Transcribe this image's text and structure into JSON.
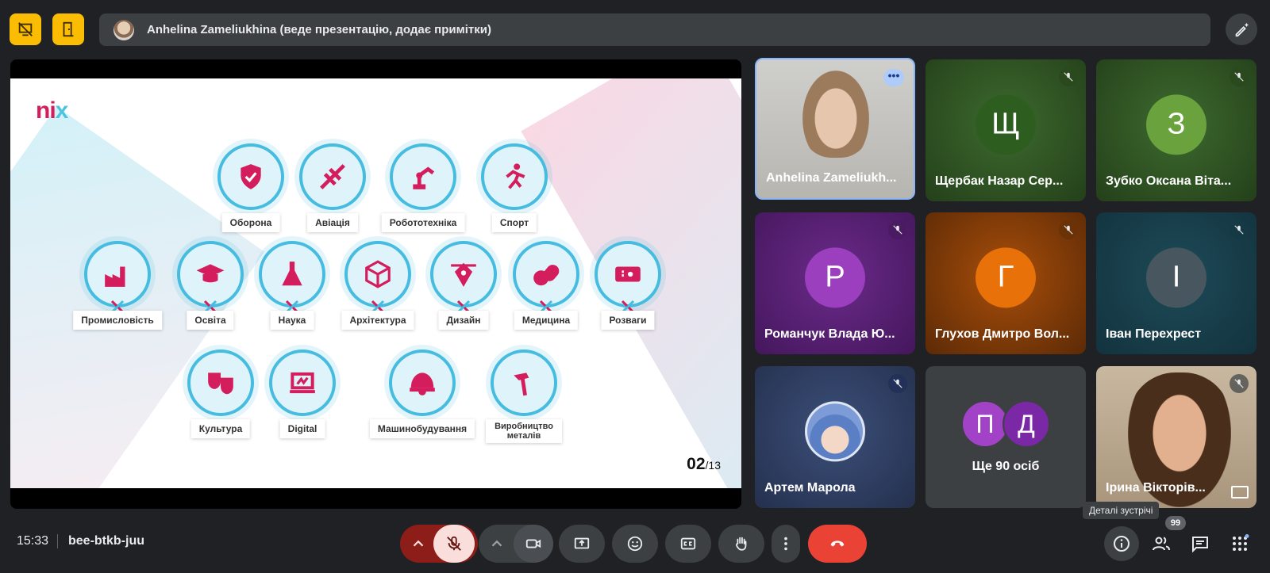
{
  "topbar": {
    "presenter_text": "Anhelina Zameliukhina (веде презентацію, додає примітки)"
  },
  "slide": {
    "logo": {
      "main": "ni",
      "accent": "x"
    },
    "page_current": "02",
    "page_total": "/13",
    "nodes": [
      {
        "label": "Оборона",
        "icon": "shield-icon"
      },
      {
        "label": "Авіація",
        "icon": "plane-icon"
      },
      {
        "label": "Робототехніка",
        "icon": "robot-arm-icon"
      },
      {
        "label": "Спорт",
        "icon": "runner-icon"
      },
      {
        "label": "Промисловість",
        "icon": "factory-icon"
      },
      {
        "label": "Освіта",
        "icon": "graduation-cap-icon"
      },
      {
        "label": "Наука",
        "icon": "flask-icon"
      },
      {
        "label": "Архітектура",
        "icon": "cube-icon"
      },
      {
        "label": "Дизайн",
        "icon": "pen-nib-icon"
      },
      {
        "label": "Медицина",
        "icon": "pills-icon"
      },
      {
        "label": "Розваги",
        "icon": "ticket-icon"
      },
      {
        "label": "Культура",
        "icon": "theater-masks-icon"
      },
      {
        "label": "Digital",
        "icon": "laptop-icon"
      },
      {
        "label": "Машинобудування",
        "icon": "helmet-icon"
      },
      {
        "label": "Виробництво металів",
        "icon": "hammer-icon"
      }
    ]
  },
  "participants": [
    {
      "name": "Anhelina Zameliukh...",
      "video": true
    },
    {
      "name": "Щербак Назар Сер...",
      "initial": "Щ",
      "color": "#2e5e1f"
    },
    {
      "name": "Зубко Оксана Віта...",
      "initial": "З",
      "color": "#6aa33e"
    },
    {
      "name": "Романчук Влада Ю...",
      "initial": "Р",
      "color": "#9c3fbf"
    },
    {
      "name": "Глухов Дмитро Вол...",
      "initial": "Г",
      "color": "#e8710a"
    },
    {
      "name": "Іван Перехрест",
      "initial": "І",
      "color": "#48575f"
    },
    {
      "name": "Артем Марола",
      "avatar": true
    },
    {
      "name": "Ще 90 осіб",
      "initials": [
        "П",
        "Д"
      ]
    },
    {
      "name": "Ірина Вікторів...",
      "video": true
    }
  ],
  "bottom": {
    "time": "15:33",
    "meeting_code": "bee-btkb-juu",
    "tooltip": "Деталі зустрічі",
    "people_count": "99"
  },
  "colors": {
    "background": "#202124",
    "accent_yellow": "#fbbc04",
    "end_call": "#ea4335",
    "brand_pink": "#d41d5c",
    "brand_cyan": "#45bce0"
  }
}
